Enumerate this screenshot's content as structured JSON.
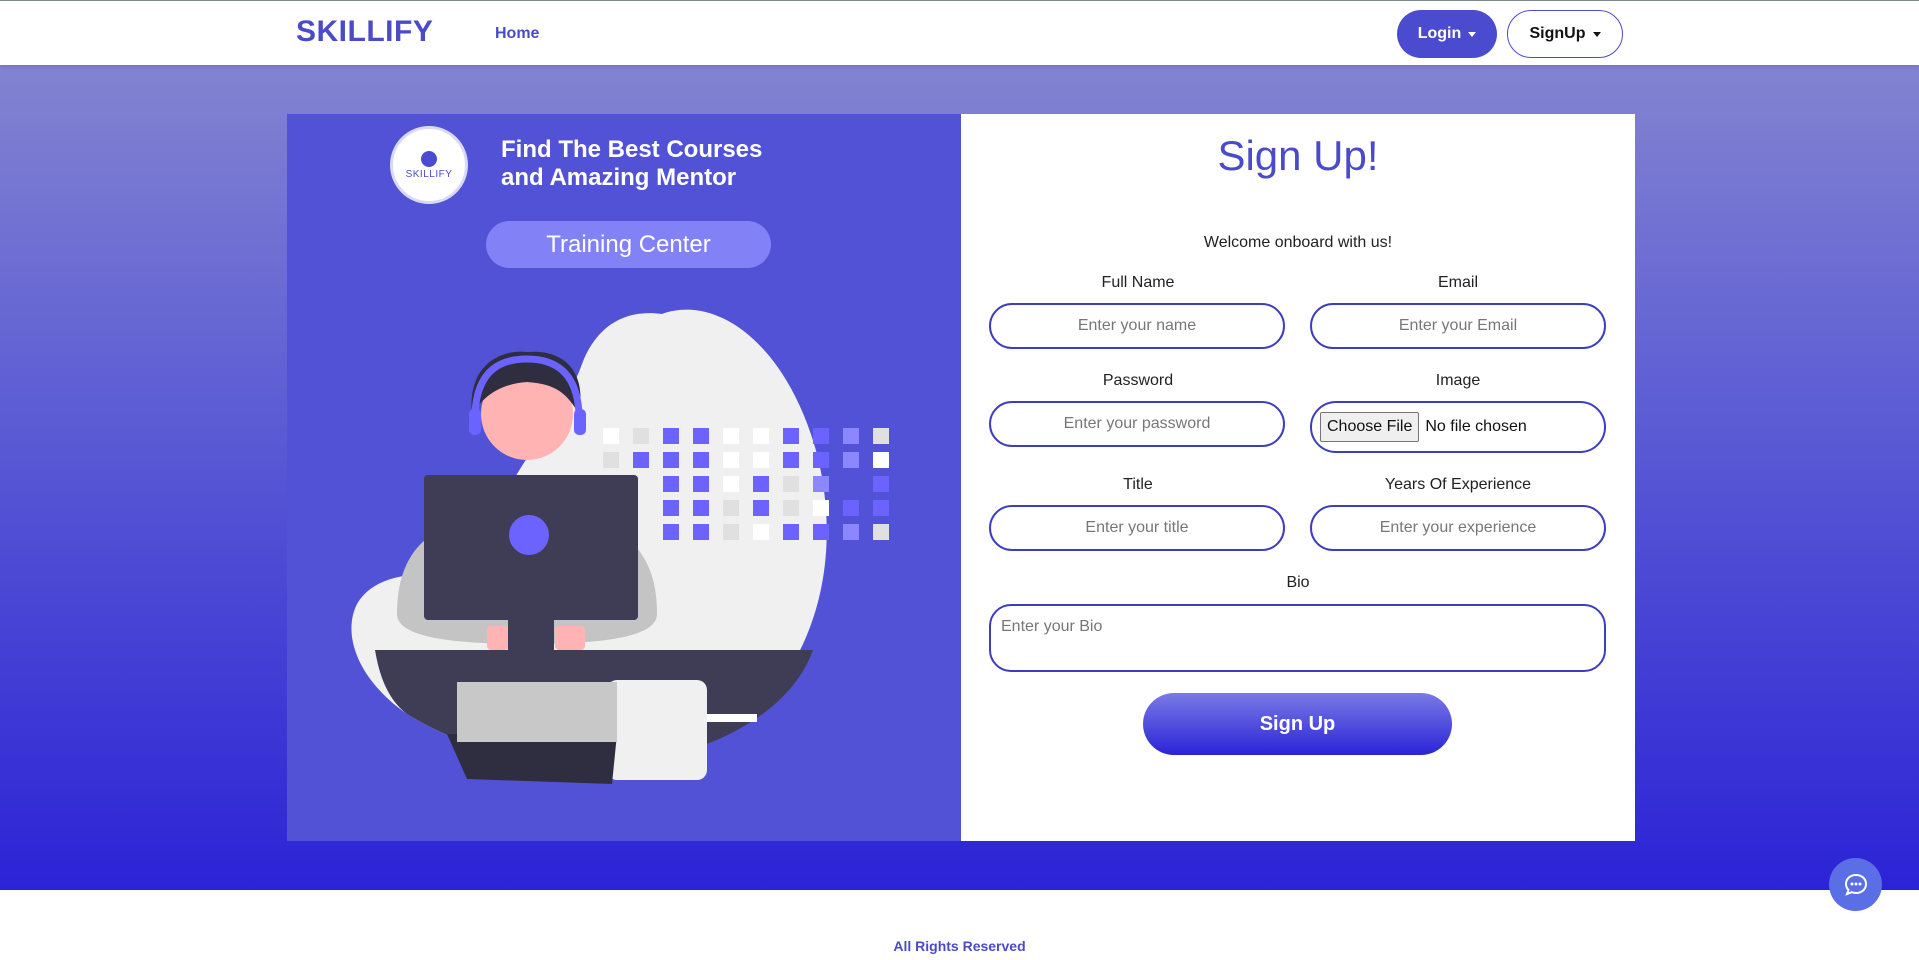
{
  "nav": {
    "brand": "SKILLIFY",
    "home": "Home",
    "login": "Login",
    "signup": "SignUp"
  },
  "hero": {
    "logo_text": "SKILLIFY",
    "heading_line1": "Find The Best Courses",
    "heading_line2": "and Amazing Mentor",
    "pill": "Training Center"
  },
  "form": {
    "title": "Sign Up!",
    "welcome": "Welcome onboard with us!",
    "full_name": {
      "label": "Full Name",
      "placeholder": "Enter your name"
    },
    "email": {
      "label": "Email",
      "placeholder": "Enter your Email"
    },
    "password": {
      "label": "Password",
      "placeholder": "Enter your password"
    },
    "image": {
      "label": "Image",
      "button": "Choose File",
      "status": "No file chosen"
    },
    "title_field": {
      "label": "Title",
      "placeholder": "Enter your title"
    },
    "experience": {
      "label": "Years Of Experience",
      "placeholder": "Enter your experience"
    },
    "bio": {
      "label": "Bio",
      "placeholder": "Enter your Bio"
    },
    "submit": "Sign Up"
  },
  "footer": {
    "text": "All Rights Reserved"
  },
  "icons": {
    "chat": "chat-bubble-icon",
    "logo": "brain-icon"
  },
  "colors": {
    "accent": "#4b4bc9",
    "panel": "#5252d6",
    "gradient_top": "#8383d2",
    "gradient_bottom": "#2b23d6"
  }
}
